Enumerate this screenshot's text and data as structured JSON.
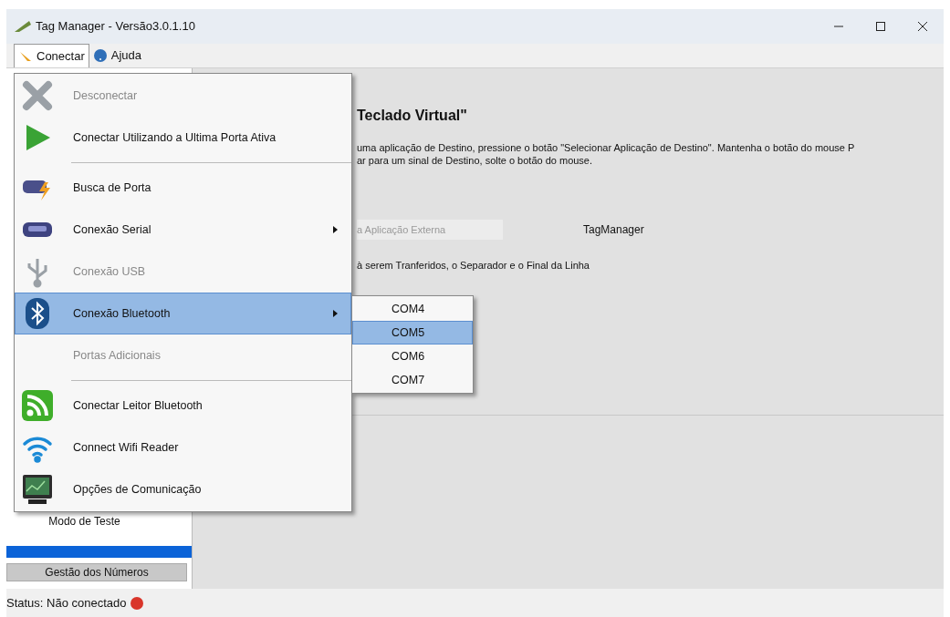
{
  "window": {
    "title": "Tag Manager - Versão3.0.1.10"
  },
  "menubar": [
    {
      "label": "Conectar",
      "selected": true
    },
    {
      "label": "Ajuda",
      "selected": false
    }
  ],
  "content": {
    "heading": "Teclado Virtual\"",
    "description": [
      "uma aplicação de Destino, pressione o botão \"Selecionar Aplicação de Destino\". Mantenha o botão do mouse P",
      "ar para um sinal de Destino, solte o botão do mouse."
    ],
    "field_value": "a Aplicação Externa",
    "app_name": "TagManager",
    "fields_label": "à serem Tranferidos, o Separador e o Final da Linha"
  },
  "sidebar": {
    "items": [
      "Modo de Teste"
    ],
    "button": "Gestão dos Números"
  },
  "menu": [
    {
      "kind": "item",
      "label": "Desconectar",
      "disabled": true,
      "selected": false,
      "submenu": false
    },
    {
      "kind": "item",
      "label": "Conectar Utilizando a Ultima Porta Ativa",
      "disabled": false,
      "selected": false,
      "submenu": false
    },
    {
      "kind": "separator"
    },
    {
      "kind": "item",
      "label": "Busca de Porta",
      "disabled": false,
      "selected": false,
      "submenu": false
    },
    {
      "kind": "item",
      "label": "Conexão Serial",
      "disabled": false,
      "selected": false,
      "submenu": true
    },
    {
      "kind": "item",
      "label": "Conexão USB",
      "disabled": true,
      "selected": false,
      "submenu": false
    },
    {
      "kind": "item",
      "label": "Conexão Bluetooth",
      "disabled": false,
      "selected": true,
      "submenu": true
    },
    {
      "kind": "item",
      "label": "Portas Adicionais",
      "disabled": true,
      "selected": false,
      "submenu": false
    },
    {
      "kind": "separator"
    },
    {
      "kind": "item",
      "label": "Conectar Leitor Bluetooth",
      "disabled": false,
      "selected": false,
      "submenu": false
    },
    {
      "kind": "item",
      "label": "Connect Wifi Reader",
      "disabled": false,
      "selected": false,
      "submenu": false
    },
    {
      "kind": "item",
      "label": "Opções de Comunicação",
      "disabled": false,
      "selected": false,
      "submenu": false
    }
  ],
  "submenu": [
    {
      "label": "COM4",
      "selected": false
    },
    {
      "label": "COM5",
      "selected": true
    },
    {
      "label": "COM6",
      "selected": false
    },
    {
      "label": "COM7",
      "selected": false
    }
  ],
  "status_bar": {
    "text": "Status: Não conectado",
    "connected": false
  }
}
